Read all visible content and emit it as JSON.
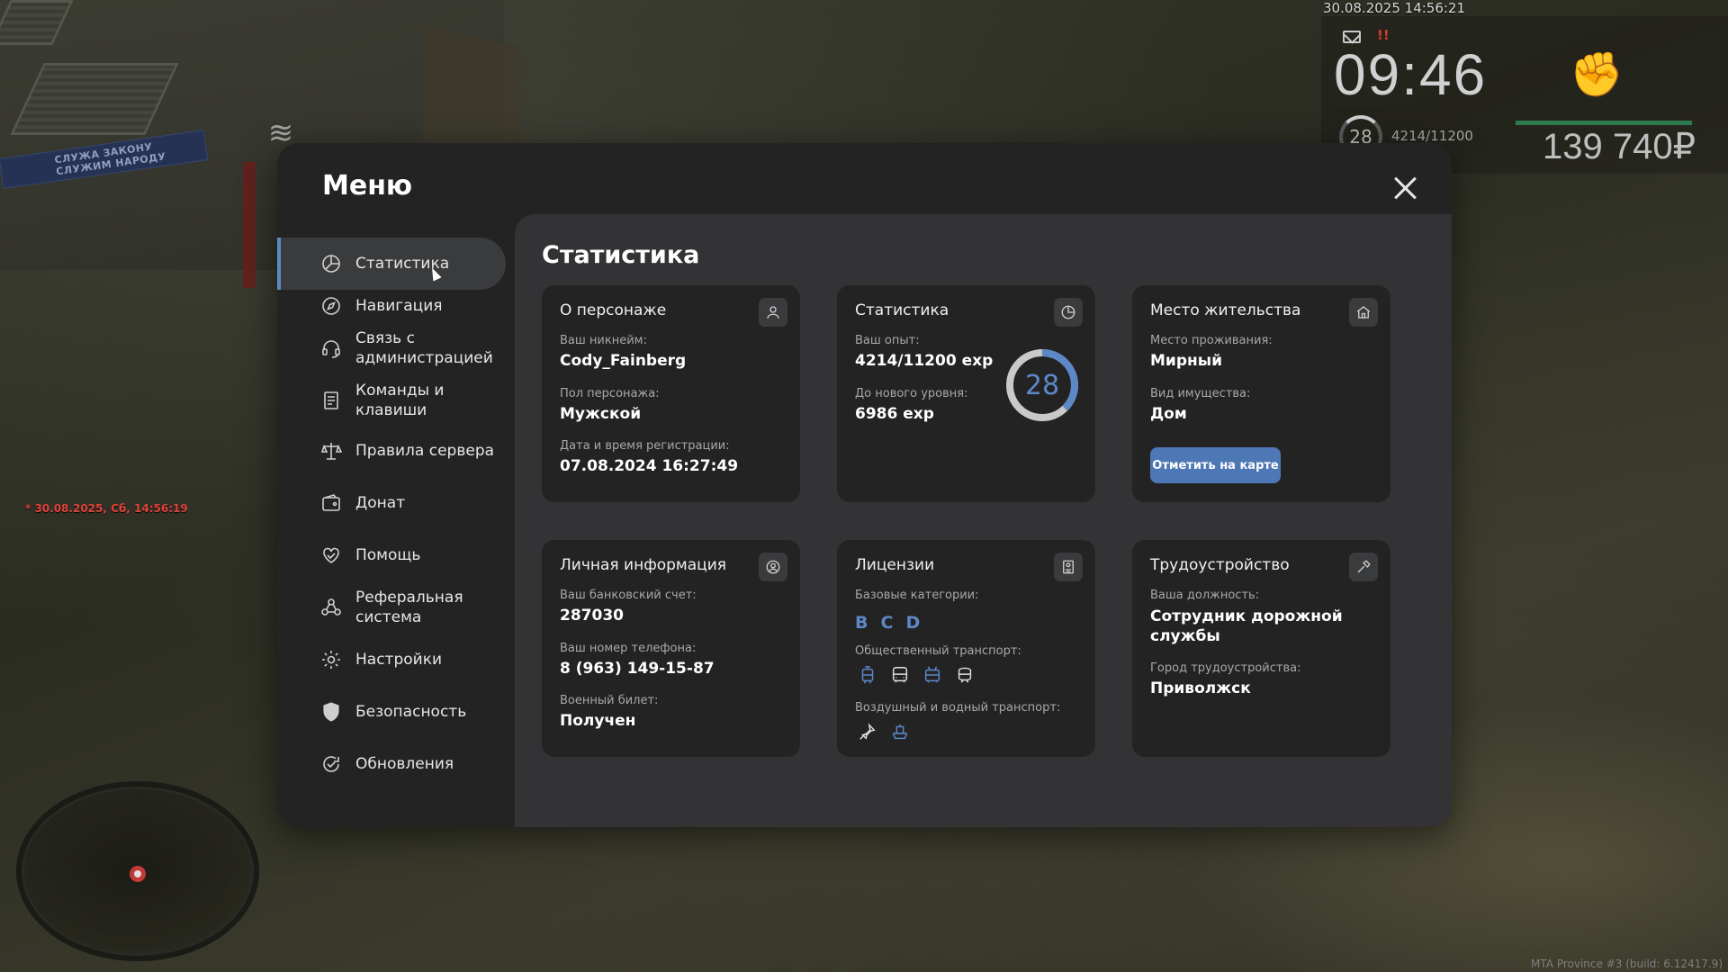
{
  "hud": {
    "datetime": "30.08.2025 14:56:21",
    "alert": "!!",
    "time": "09:46",
    "level": "28",
    "exp": "4214/11200",
    "money": "139 740₽",
    "chat_line": "* 30.08.2025, Сб, 14:56:19",
    "build": "MTA Province #3 (build: 6.12417.9)",
    "sign_text": "СЛУЖА ЗАКОНУ\nСЛУЖИМ НАРОДУ"
  },
  "menu": {
    "title": "Меню",
    "nav": [
      {
        "label": "Статистика",
        "icon": "chart-pie-icon"
      },
      {
        "label": "Навигация",
        "icon": "compass-icon"
      },
      {
        "label": "Связь с\nадминистрацией",
        "icon": "headset-icon"
      },
      {
        "label": "Команды и\nклавиши",
        "icon": "document-list-icon"
      },
      {
        "label": "Правила сервера",
        "icon": "scales-icon"
      },
      {
        "label": "Донат",
        "icon": "wallet-icon"
      },
      {
        "label": "Помощь",
        "icon": "heart-hands-icon"
      },
      {
        "label": "Реферальная\nсистема",
        "icon": "referral-icon"
      },
      {
        "label": "Настройки",
        "icon": "gear-icon"
      },
      {
        "label": "Безопасность",
        "icon": "shield-icon"
      },
      {
        "label": "Обновления",
        "icon": "refresh-check-icon"
      }
    ],
    "active_index": 0
  },
  "content": {
    "title": "Статистика",
    "about": {
      "title": "О персонаже",
      "nick_label": "Ваш никнейм:",
      "nick": "Cody_Fainberg",
      "gender_label": "Пол персонажа:",
      "gender": "Мужской",
      "reg_label": "Дата и время регистрации:",
      "reg": "07.08.2024 16:27:49"
    },
    "stats": {
      "title": "Статистика",
      "exp_label": "Ваш опыт:",
      "exp": "4214/11200 exp",
      "next_label": "До нового уровня:",
      "next": "6986 exp",
      "level": "28",
      "progress": 0.376
    },
    "residence": {
      "title": "Место жительства",
      "place_label": "Место проживания:",
      "place": "Мирный",
      "type_label": "Вид имущества:",
      "type": "Дом",
      "button": "Отметить на карте"
    },
    "personal": {
      "title": "Личная информация",
      "bank_label": "Ваш банковский счет:",
      "bank": "287030",
      "phone_label": "Ваш номер телефона:",
      "phone": "8 (963) 149-15-87",
      "military_label": "Военный билет:",
      "military": "Получен"
    },
    "licenses": {
      "title": "Лицензии",
      "base_label": "Базовые категории:",
      "categories": [
        "B",
        "C",
        "D"
      ],
      "public_label": "Общественный транспорт:",
      "public_icons": [
        "tram-icon",
        "bus-icon",
        "trolleybus-icon",
        "metro-icon"
      ],
      "air_label": "Воздушный и водный транспорт:",
      "air_icons": [
        "plane-icon",
        "boat-icon"
      ]
    },
    "job": {
      "title": "Трудоустройство",
      "position_label": "Ваша должность:",
      "position": "Сотрудник дорожной службы",
      "city_label": "Город трудоустройства:",
      "city": "Приволжск"
    }
  },
  "colors": {
    "accent": "#5d88c8",
    "button": "#4e78b5",
    "window_bg": "#232324",
    "content_bg": "#333335",
    "card_bg": "#232324"
  }
}
